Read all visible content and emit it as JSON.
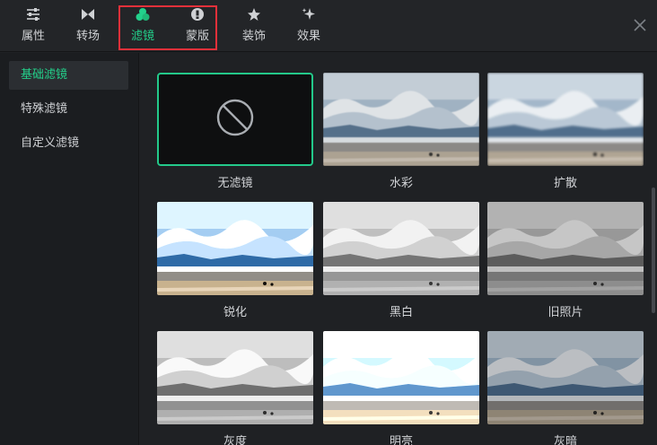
{
  "toolbar": {
    "tabs": [
      {
        "label": "属性",
        "icon": "sliders-icon"
      },
      {
        "label": "转场",
        "icon": "transition-icon"
      },
      {
        "label": "滤镜",
        "icon": "filter-icon"
      },
      {
        "label": "蒙版",
        "icon": "mask-icon"
      },
      {
        "label": "装饰",
        "icon": "decoration-icon"
      },
      {
        "label": "效果",
        "icon": "effect-sparkle-icon"
      }
    ],
    "active_tab": "滤镜",
    "close_icon": "close-icon"
  },
  "sidebar": {
    "items": [
      {
        "label": "基础滤镜"
      },
      {
        "label": "特殊滤镜"
      },
      {
        "label": "自定义滤镜"
      }
    ],
    "active_item": "基础滤镜"
  },
  "filters": {
    "items": [
      {
        "label": "无滤镜",
        "kind": "none",
        "icon": "no-filter-icon"
      },
      {
        "label": "水彩",
        "kind": "watercolor"
      },
      {
        "label": "扩散",
        "kind": "diffuse"
      },
      {
        "label": "锐化",
        "kind": "sharpen"
      },
      {
        "label": "黑白",
        "kind": "blackwhite"
      },
      {
        "label": "旧照片",
        "kind": "oldphoto"
      },
      {
        "label": "灰度",
        "kind": "grayscale"
      },
      {
        "label": "明亮",
        "kind": "bright"
      },
      {
        "label": "灰暗",
        "kind": "dim"
      }
    ],
    "selected": "无滤镜"
  },
  "colors": {
    "accent": "#23d18b",
    "highlight_border": "#e5303a",
    "background": "#1f2124"
  }
}
